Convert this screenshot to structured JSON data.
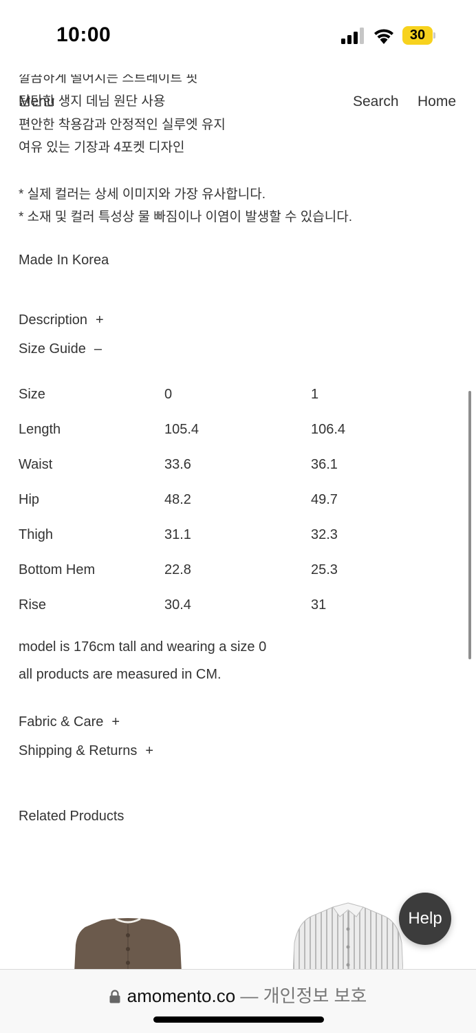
{
  "status_bar": {
    "time": "10:00",
    "battery": "30"
  },
  "nav": {
    "menu": "Menu",
    "search": "Search",
    "home": "Home"
  },
  "description_lines": [
    "깔끔하게 떨어지는 스트레이트 핏",
    "탄탄한 생지 데님 원단 사용",
    "편안한 착용감과 안정적인 실루엣 유지",
    "여유 있는 기장과 4포켓 디자인",
    "* 실제 컬러는 상세 이미지와 가장 유사합니다.",
    "* 소재 및 컬러 특성상 물 빠짐이나 이염이 발생할 수 있습니다."
  ],
  "made_in": "Made In Korea",
  "accordions": {
    "description": {
      "label": "Description",
      "sign": "+"
    },
    "size_guide": {
      "label": "Size Guide",
      "sign": "–"
    },
    "fabric": {
      "label": "Fabric & Care",
      "sign": "+"
    },
    "shipping": {
      "label": "Shipping & Returns",
      "sign": "+"
    }
  },
  "size_table": [
    [
      "Size",
      "0",
      "1"
    ],
    [
      "Length",
      "105.4",
      "106.4"
    ],
    [
      "Waist",
      "33.6",
      "36.1"
    ],
    [
      "Hip",
      "48.2",
      "49.7"
    ],
    [
      "Thigh",
      "31.1",
      "32.3"
    ],
    [
      "Bottom Hem",
      "22.8",
      "25.3"
    ],
    [
      "Rise",
      "30.4",
      "31"
    ]
  ],
  "size_notes": {
    "model": "model is 176cm tall and wearing a size 0",
    "units": "all products are measured in CM."
  },
  "related_title": "Related Products",
  "help_label": "Help",
  "browser": {
    "domain": "amomento.co",
    "separator": " — ",
    "privacy": "개인정보 보호"
  },
  "colors": {
    "text": "#2a2a2a",
    "help_bg": "#3c3c3c",
    "battery": "#f7d21e"
  },
  "icons": [
    "signal-icon",
    "wifi-icon",
    "battery-icon",
    "lock-icon"
  ]
}
